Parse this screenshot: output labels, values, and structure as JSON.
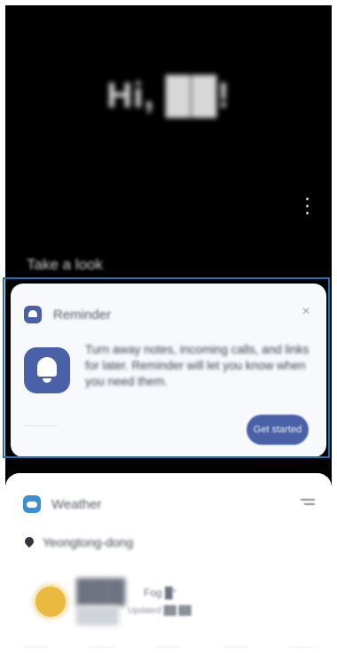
{
  "greeting": {
    "text": "Hi, ██!"
  },
  "footer_hint": {
    "text": "Take a look"
  },
  "reminder_card": {
    "title": "Reminder",
    "close_symbol": "×",
    "description": "Turn away notes, incoming calls, and links for later. Reminder will let you know when you need them.",
    "action_label": "Get started",
    "accent_color": "#4a61a8",
    "highlight_color": "#1576b8",
    "icons": [
      "reminder-app-icon",
      "bell-icon",
      "close-icon"
    ]
  },
  "weather_card": {
    "title": "Weather",
    "location": "Yeongtong-dong",
    "temperature": "███",
    "condition": "Fog █°",
    "updated": "Updated ██:██",
    "icons": [
      "weather-app-icon",
      "menu-icon",
      "location-pin-icon",
      "sun-icon"
    ]
  }
}
